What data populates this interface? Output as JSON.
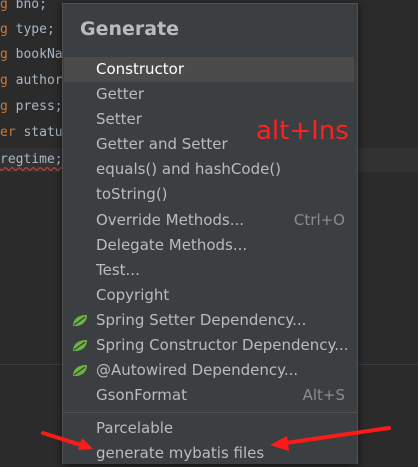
{
  "code": {
    "lines": [
      {
        "kw": "g",
        "rest": " bno;"
      },
      {
        "kw": "g",
        "rest": " type;"
      },
      {
        "kw": "g",
        "rest": " bookNa"
      },
      {
        "kw": "g",
        "rest": " author"
      },
      {
        "kw": "g",
        "rest": " press;"
      },
      {
        "kw": "er",
        "rest": " statu"
      },
      {
        "kw": "",
        "rest": "regtime;"
      }
    ]
  },
  "popup": {
    "title": "Generate",
    "items": [
      {
        "label": "Constructor",
        "shortcut": "",
        "icon": ""
      },
      {
        "label": "Getter",
        "shortcut": "",
        "icon": ""
      },
      {
        "label": "Setter",
        "shortcut": "",
        "icon": ""
      },
      {
        "label": "Getter and Setter",
        "shortcut": "",
        "icon": ""
      },
      {
        "label": "equals() and hashCode()",
        "shortcut": "",
        "icon": ""
      },
      {
        "label": "toString()",
        "shortcut": "",
        "icon": ""
      },
      {
        "label": "Override Methods...",
        "shortcut": "Ctrl+O",
        "icon": ""
      },
      {
        "label": "Delegate Methods...",
        "shortcut": "",
        "icon": ""
      },
      {
        "label": "Test...",
        "shortcut": "",
        "icon": ""
      },
      {
        "label": "Copyright",
        "shortcut": "",
        "icon": ""
      },
      {
        "label": "Spring Setter Dependency...",
        "shortcut": "",
        "icon": "spring-leaf-icon"
      },
      {
        "label": "Spring Constructor Dependency...",
        "shortcut": "",
        "icon": "spring-leaf-icon"
      },
      {
        "label": "@Autowired Dependency...",
        "shortcut": "",
        "icon": "spring-leaf-icon"
      },
      {
        "label": "GsonFormat",
        "shortcut": "Alt+S",
        "icon": ""
      },
      {
        "label": "Parcelable",
        "shortcut": "",
        "icon": ""
      },
      {
        "label": "generate mybatis files",
        "shortcut": "",
        "icon": ""
      }
    ],
    "selected_index": 0
  },
  "annotation": {
    "text": "alt+Ins",
    "color": "#ff2020"
  },
  "colors": {
    "spring_leaf": "#6db33f",
    "keyword": "#cc7832"
  }
}
